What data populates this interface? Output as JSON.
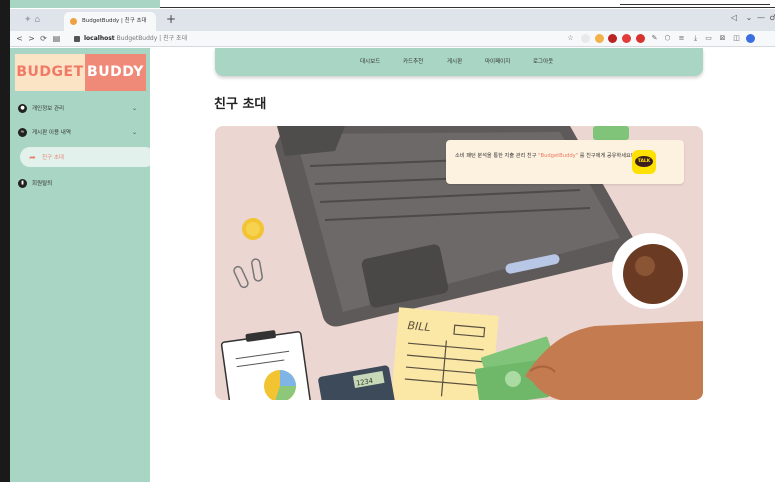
{
  "browser": {
    "tab_title": "BudgetBuddy | 친구 초대",
    "new_tab": "+",
    "back": "<",
    "forward": ">",
    "reload": "⟳",
    "url_host": "localhost",
    "url_rest": "BudgetBuddy | 친구 초대",
    "window_minimize": "—",
    "window_close": "♂"
  },
  "sidebar": {
    "logo_left": "BUDGET",
    "logo_right": "BUDDY",
    "items": [
      {
        "label": "개인정보 관리",
        "icon": "user-icon",
        "expandable": true
      },
      {
        "label": "게시판 이용 내역",
        "icon": "chat-icon",
        "expandable": true
      },
      {
        "label": "친구 초대",
        "icon": "share-icon",
        "active": true
      },
      {
        "label": "회원탈퇴",
        "icon": "trash-icon"
      }
    ]
  },
  "topnav": {
    "items": [
      "대시보드",
      "카드추천",
      "게시판",
      "마이페이지",
      "로그아웃"
    ]
  },
  "page": {
    "title": "친구 초대"
  },
  "invite": {
    "message_before": "소비 패턴 분석을 통한 지출 관리 친구 ",
    "highlight": "\"BudgetBuddy\"",
    "message_after": " 를 친구에게 공유하세요!",
    "talk_label": "TALK"
  },
  "illustration": {
    "bill_label": "BILL",
    "calc_display": "1234"
  },
  "colors": {
    "mint": "#a9d5c4",
    "coral": "#f08a78",
    "peach": "#fbe3c6",
    "kakao_yellow": "#ffe100"
  }
}
